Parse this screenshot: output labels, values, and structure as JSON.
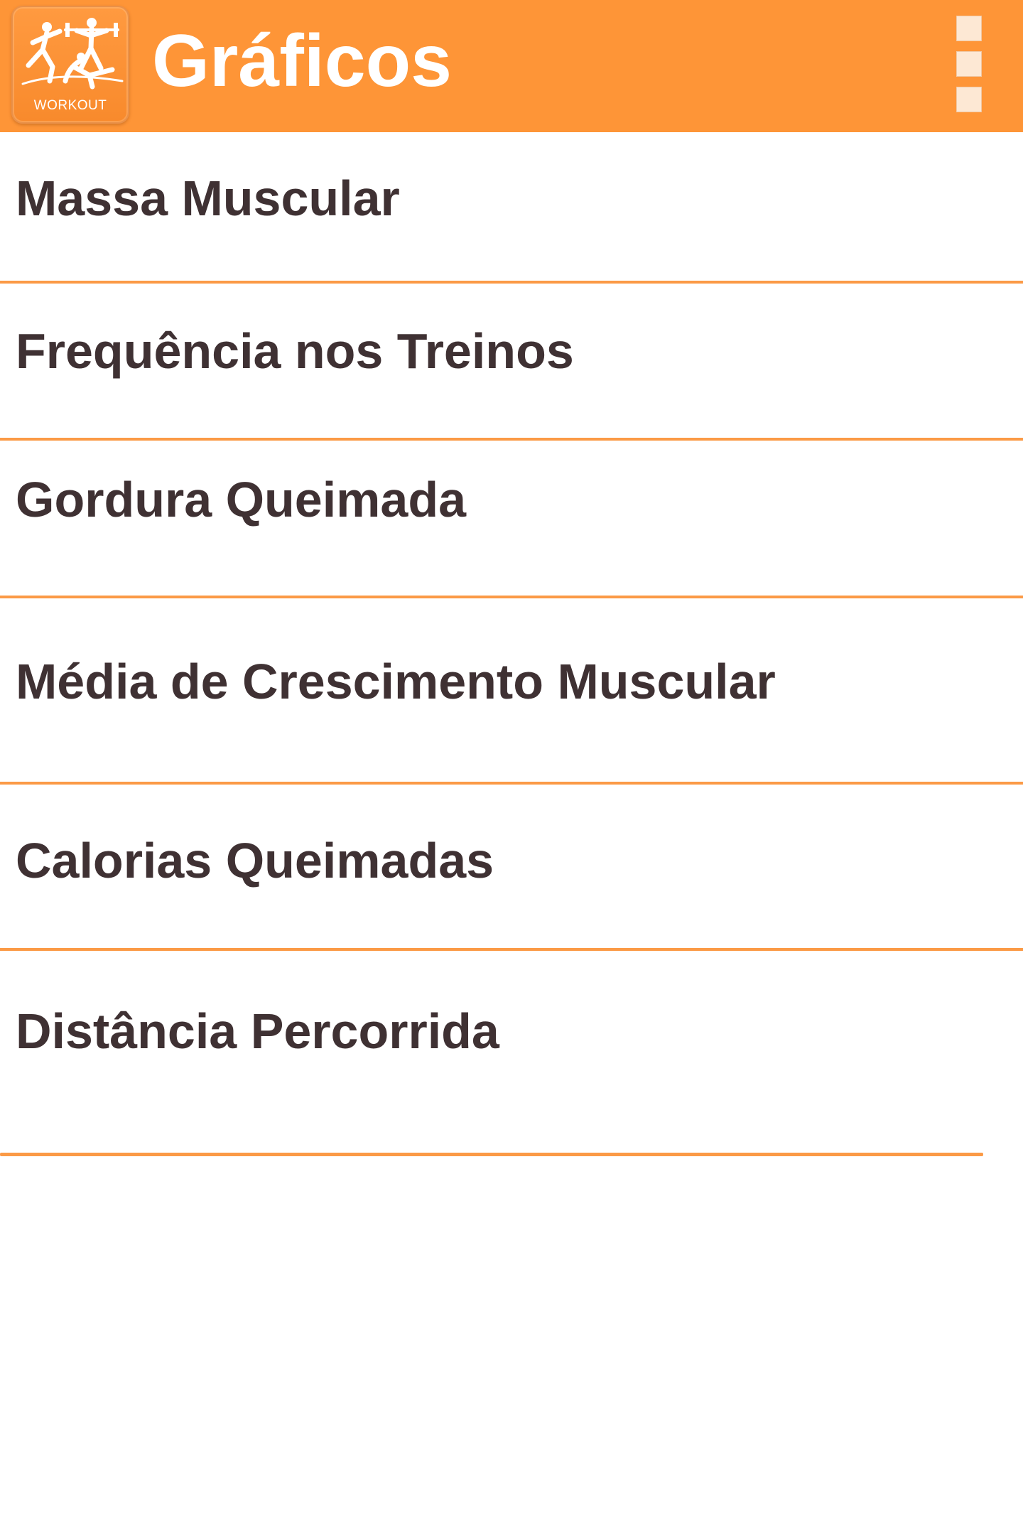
{
  "app_bar": {
    "title": "Gráficos",
    "logo_caption": "WORKOUT",
    "logo_icon": "athletes-logo-icon",
    "menu_icon": "overflow-menu-icon"
  },
  "colors": {
    "primary": "#fe9537",
    "divider": "#fb9a46",
    "text": "#3f3133",
    "background": "#ffffff"
  },
  "menu": {
    "items": [
      {
        "label": "Massa Muscular"
      },
      {
        "label": "Frequência nos Treinos"
      },
      {
        "label": "Gordura Queimada"
      },
      {
        "label": "Média de Crescimento Muscular"
      },
      {
        "label": "Calorias Queimadas"
      },
      {
        "label": "Distância Percorrida"
      }
    ]
  }
}
